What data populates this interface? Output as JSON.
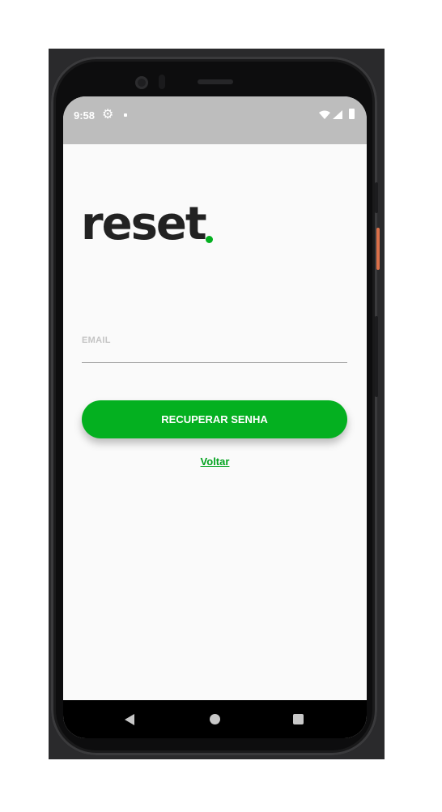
{
  "status_bar": {
    "time": "9:58",
    "icons": [
      "gear-icon",
      "notification-dot-icon",
      "wifi-icon",
      "signal-icon",
      "battery-icon"
    ]
  },
  "logo": {
    "text": "reset",
    "dot_color": "#04b020"
  },
  "form": {
    "email_label": "EMAIL",
    "email_value": ""
  },
  "actions": {
    "recover_label": "RECUPERAR SENHA",
    "back_label": "Voltar"
  },
  "colors": {
    "accent": "#04b020",
    "status_bar": "#bdbdbd",
    "text_dark": "#222222"
  },
  "navigation": {
    "icons": [
      "back-icon",
      "home-icon",
      "recents-icon"
    ]
  }
}
